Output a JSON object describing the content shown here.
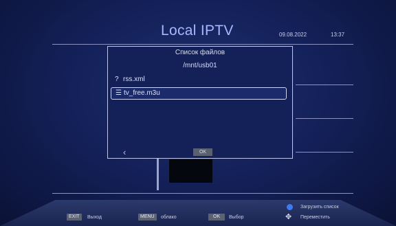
{
  "header": {
    "title": "Local IPTV",
    "date": "09.08.2022",
    "time": "13:37"
  },
  "dialog": {
    "title": "Список файлов",
    "path": "/mnt/usb01",
    "files": [
      {
        "icon": "?",
        "name": "rss.xml",
        "selected": false
      },
      {
        "icon": "☰",
        "name": "tv_free.m3u",
        "selected": true
      }
    ],
    "back_icon": "‹",
    "ok_label": "OK"
  },
  "footer": {
    "exit_key": "EXIT",
    "exit_label": "Выход",
    "menu_key": "MENU",
    "menu_label": "облако",
    "ok_key": "OK",
    "ok_label": "Выбор",
    "blue_label": "Загрузить список",
    "move_label": "Переместить"
  },
  "colors": {
    "background": "#14215a",
    "title": "#a7b8ff",
    "blue_button": "#3c7bf0"
  }
}
